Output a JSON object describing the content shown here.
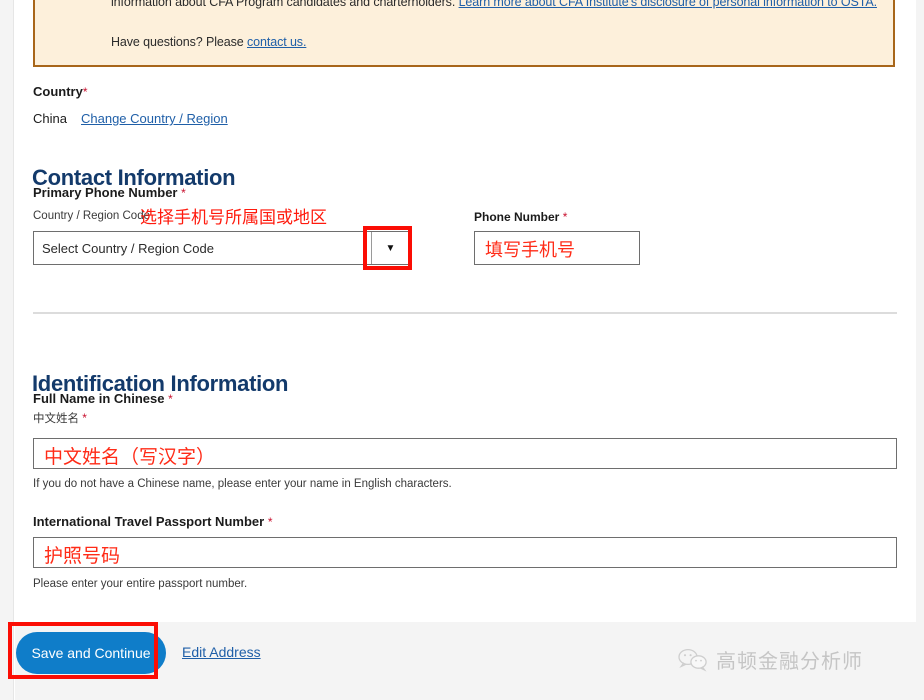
{
  "notice_banner": {
    "line1_text": "information about CFA Program candidates and charterholders.",
    "line1_link": "Learn more about CFA Institute's disclosure of personal information to OSTA.",
    "line2_text": "Have questions? Please",
    "line2_link": "contact us.",
    "border_color": "#a8661a",
    "background_color": "#fdf0db"
  },
  "country_section": {
    "label": "Country",
    "required_marker": "*",
    "value": "China",
    "change_link": "Change Country / Region"
  },
  "contact_section": {
    "heading": "Contact Information",
    "phone_group_label": "Primary Phone Number",
    "phone_group_required": "*",
    "country_code_label": "Country / Region Code",
    "country_code_selected": "Select Country / Region Code",
    "country_code_arrow": "chevron-down-icon",
    "phone_number_label": "Phone Number",
    "phone_number_required": "*",
    "phone_number_value": "填写手机号"
  },
  "identification_section": {
    "heading": "Identification Information",
    "full_name_label": "Full Name in Chinese",
    "full_name_required": "*",
    "full_name_sub_label": "中文姓名",
    "full_name_sub_required": "*",
    "full_name_value": "中文姓名（写汉字）",
    "full_name_help": "If you do not have a Chinese name, please enter your name in English characters.",
    "passport_label": "International Travel Passport Number",
    "passport_required": "*",
    "passport_value": "护照号码",
    "passport_help": "Please enter your entire passport number."
  },
  "footer": {
    "save_button": "Save and Continue",
    "edit_address_link": "Edit Address"
  },
  "annotations": {
    "country_code_hint": "选择手机号所属国或地区",
    "annotation_color": "#fb0d04"
  },
  "watermark": {
    "icon": "wechat-icon",
    "label": "高顿金融分析师"
  },
  "colors": {
    "heading_blue": "#133a6b",
    "link_blue": "#1f5fa8",
    "button_blue": "#0f7dc9",
    "required_red": "#c8102e",
    "annotation_red": "#fb0d04",
    "page_background": "#ffffff",
    "footer_background": "#f4f4f4"
  }
}
